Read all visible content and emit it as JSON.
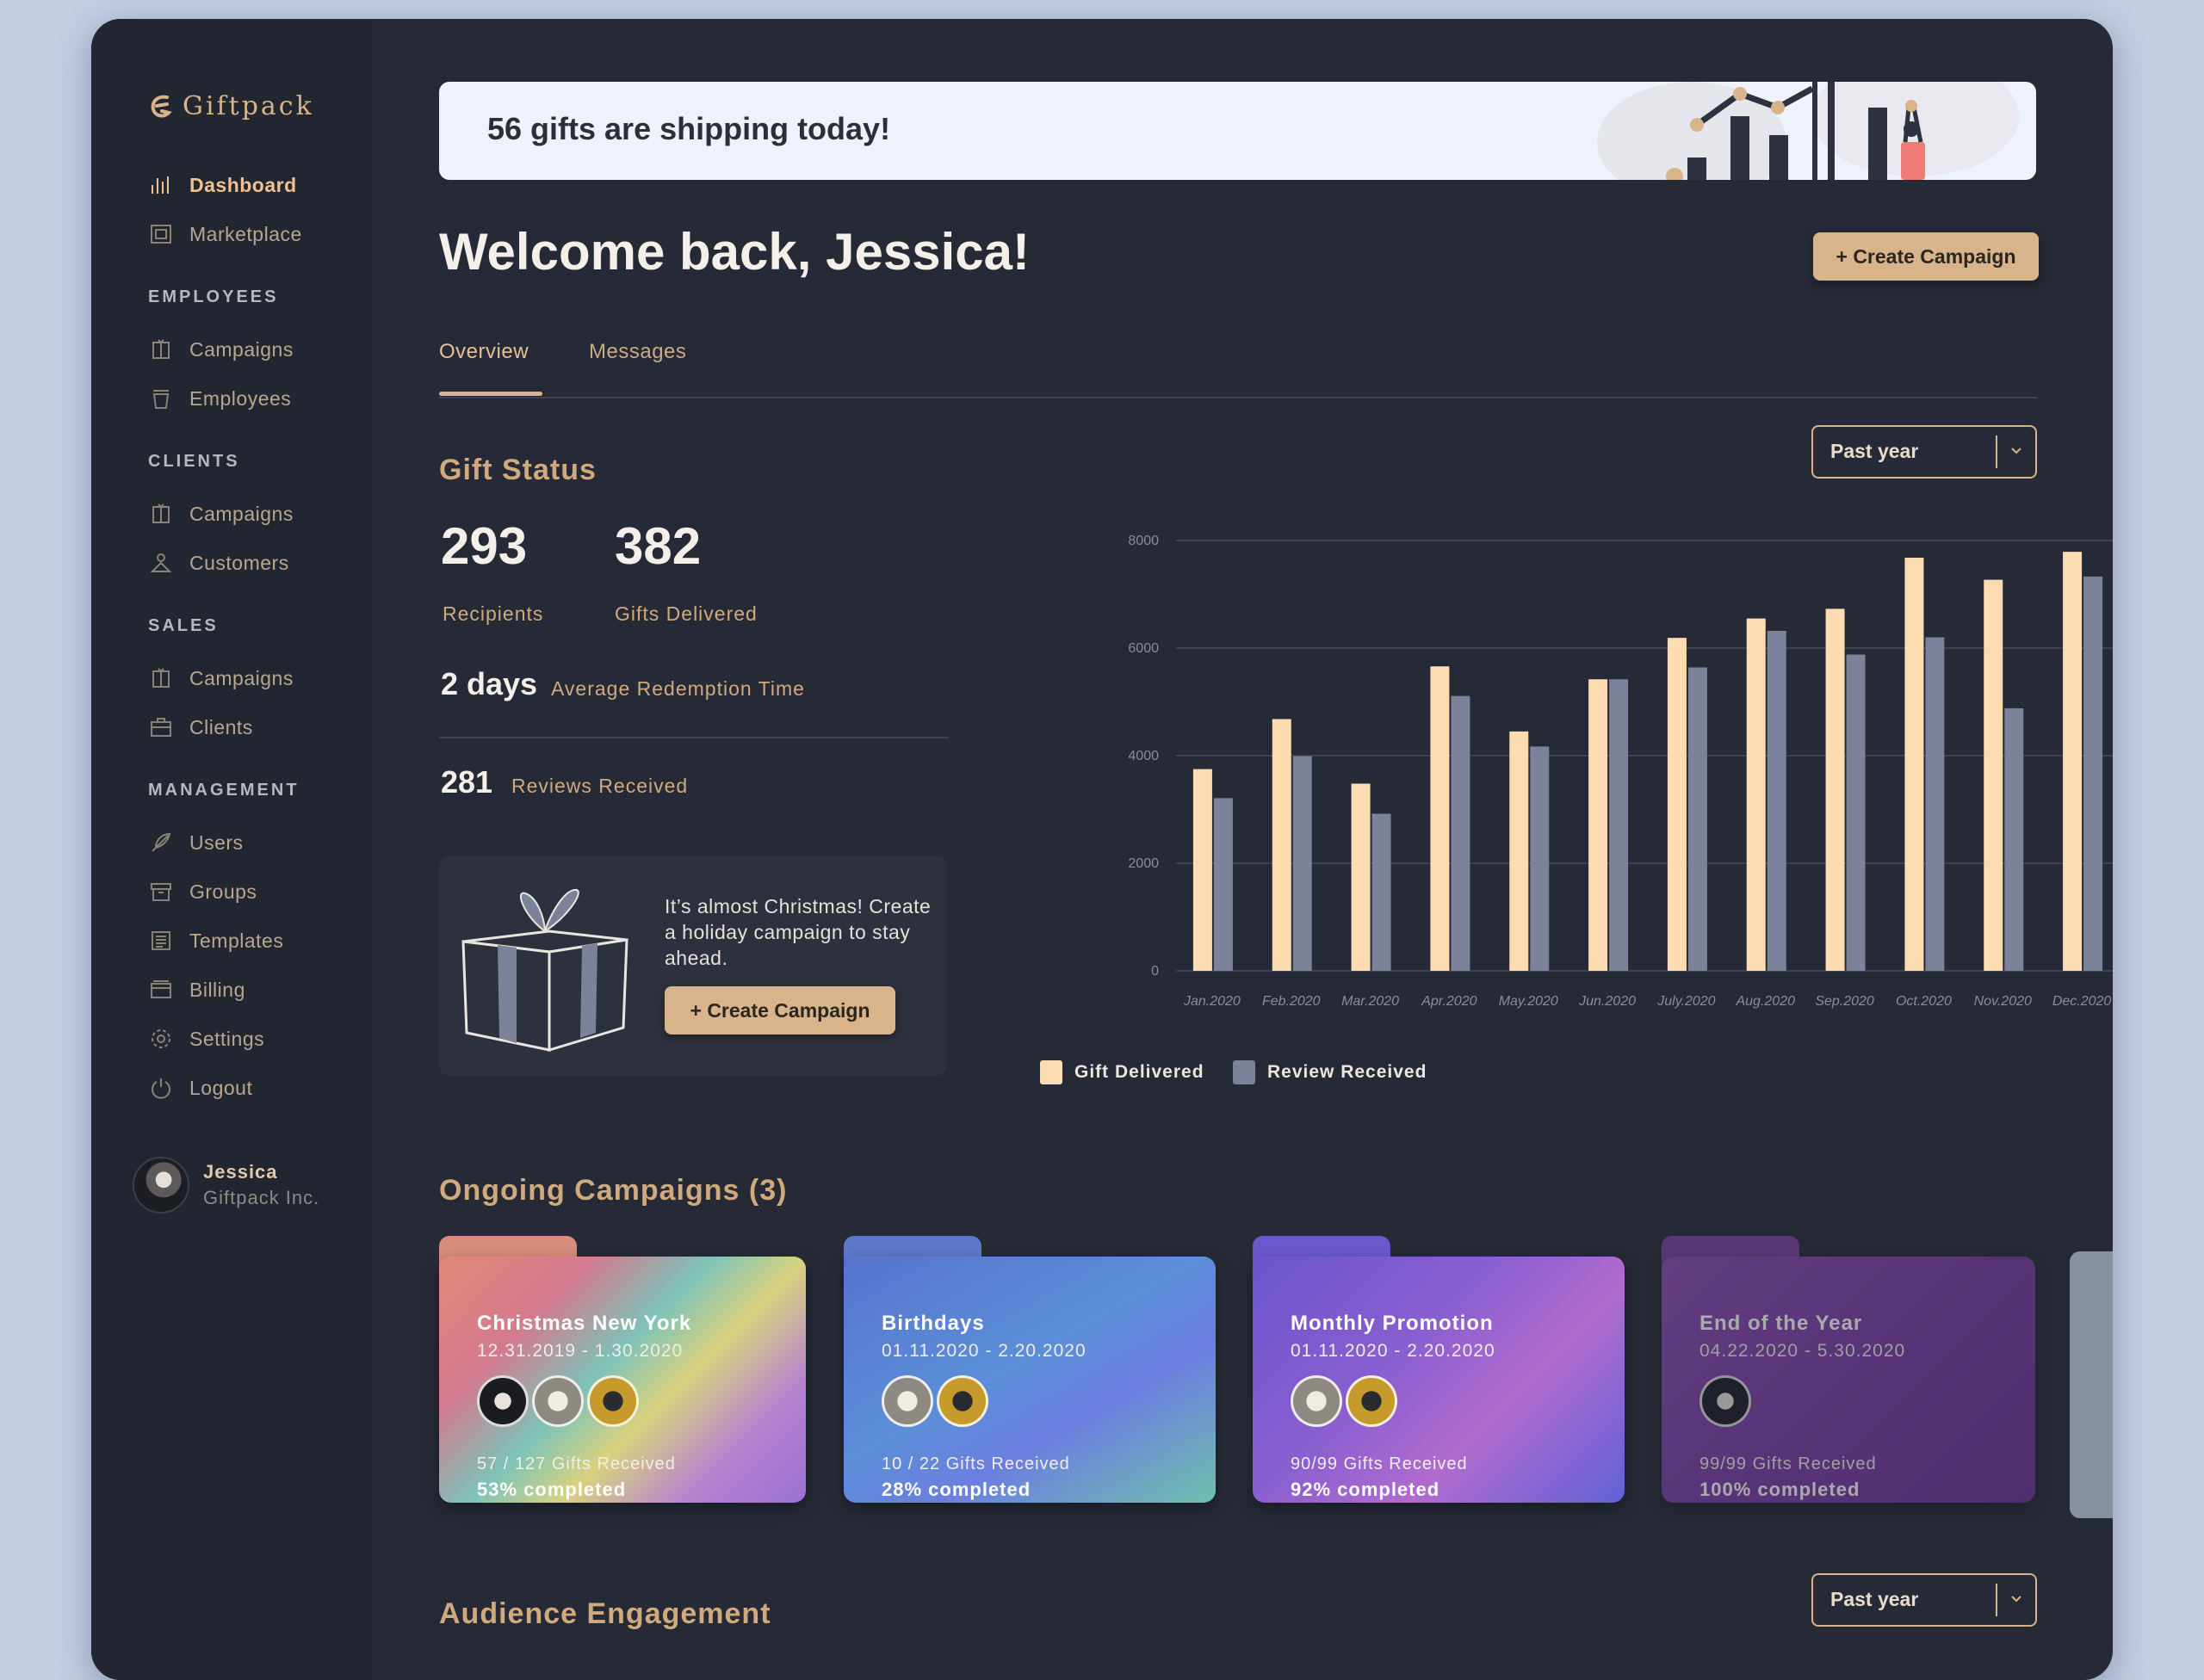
{
  "app": {
    "name": "Giftpack"
  },
  "sidebar": {
    "top_items": [
      {
        "label": "Dashboard",
        "icon": "bar-chart-icon",
        "active": true
      },
      {
        "label": "Marketplace",
        "icon": "storefront-icon"
      }
    ],
    "sections": [
      {
        "title": "EMPLOYEES",
        "items": [
          {
            "label": "Campaigns",
            "icon": "gift-box-icon"
          },
          {
            "label": "Employees",
            "icon": "cup-icon"
          }
        ]
      },
      {
        "title": "CLIENTS",
        "items": [
          {
            "label": "Campaigns",
            "icon": "gift-box-icon"
          },
          {
            "label": "Customers",
            "icon": "person-icon"
          }
        ]
      },
      {
        "title": "SALES",
        "items": [
          {
            "label": "Campaigns",
            "icon": "gift-box-icon"
          },
          {
            "label": "Clients",
            "icon": "briefcase-icon"
          }
        ]
      },
      {
        "title": "MANAGEMENT",
        "items": [
          {
            "label": "Users",
            "icon": "feather-icon"
          },
          {
            "label": "Groups",
            "icon": "archive-icon"
          },
          {
            "label": "Templates",
            "icon": "newspaper-icon"
          },
          {
            "label": "Billing",
            "icon": "wallet-icon"
          },
          {
            "label": "Settings",
            "icon": "gear-icon"
          },
          {
            "label": "Logout",
            "icon": "power-icon"
          }
        ]
      }
    ],
    "user": {
      "name": "Jessica",
      "org": "Giftpack Inc."
    }
  },
  "banner": {
    "text": "56 gifts are shipping today!"
  },
  "header": {
    "welcome": "Welcome back, Jessica!",
    "create_label": "+ Create Campaign"
  },
  "tabs": [
    {
      "label": "Overview",
      "active": true
    },
    {
      "label": "Messages"
    }
  ],
  "gift_status": {
    "title": "Gift Status",
    "range": "Past year",
    "recipients": {
      "value": "293",
      "label": "Recipients"
    },
    "gifts_delivered": {
      "value": "382",
      "label": "Gifts Delivered"
    },
    "redemption": {
      "value": "2 days",
      "label": "Average Redemption Time"
    },
    "reviews": {
      "value": "281",
      "label": "Reviews Received"
    },
    "promo": {
      "text": "It’s almost Christmas! Create a holiday campaign to stay ahead.",
      "button": "+ Create Campaign"
    }
  },
  "chart_data": {
    "type": "bar",
    "categories": [
      "Jan.2020",
      "Feb.2020",
      "Mar.2020",
      "Apr.2020",
      "May.2020",
      "Jun.2020",
      "July.2020",
      "Aug.2020",
      "Sep.2020",
      "Oct.2020",
      "Nov.2020",
      "Dec.2020"
    ],
    "series": [
      {
        "name": "Gift Delivered",
        "color": "#fcdcb0",
        "values": [
          3750,
          4680,
          3480,
          5660,
          4450,
          5420,
          6190,
          6550,
          6730,
          7680,
          7270,
          7790
        ]
      },
      {
        "name": "Review Received",
        "color": "#7b8299",
        "values": [
          3210,
          3990,
          2920,
          5110,
          4170,
          5420,
          5640,
          6320,
          5880,
          6200,
          4880,
          7330
        ]
      }
    ],
    "yticks": [
      0,
      2000,
      4000,
      6000,
      8000
    ],
    "ylim": [
      0,
      8000
    ],
    "grid": true,
    "legend": "bottom-left"
  },
  "ongoing": {
    "title": "Ongoing Campaigns (3)",
    "campaigns": [
      {
        "title": "Christmas New York",
        "dates": "12.31.2019 - 1.30.2020",
        "received": "57 / 127 Gifts Received",
        "completed": "53% completed",
        "avatars": 3
      },
      {
        "title": "Birthdays",
        "dates": "01.11.2020 - 2.20.2020",
        "received": "10 / 22 Gifts Received",
        "completed": "28% completed",
        "avatars": 2
      },
      {
        "title": "Monthly Promotion",
        "dates": "01.11.2020 - 2.20.2020",
        "received": "90/99 Gifts Received",
        "completed": "92% completed",
        "avatars": 2
      },
      {
        "title": "End of the Year",
        "dates": "04.22.2020 - 5.30.2020",
        "received": "99/99 Gifts Received",
        "completed": "100% completed",
        "avatars": 1
      }
    ]
  },
  "audience": {
    "title": "Audience Engagement",
    "range": "Past year"
  }
}
